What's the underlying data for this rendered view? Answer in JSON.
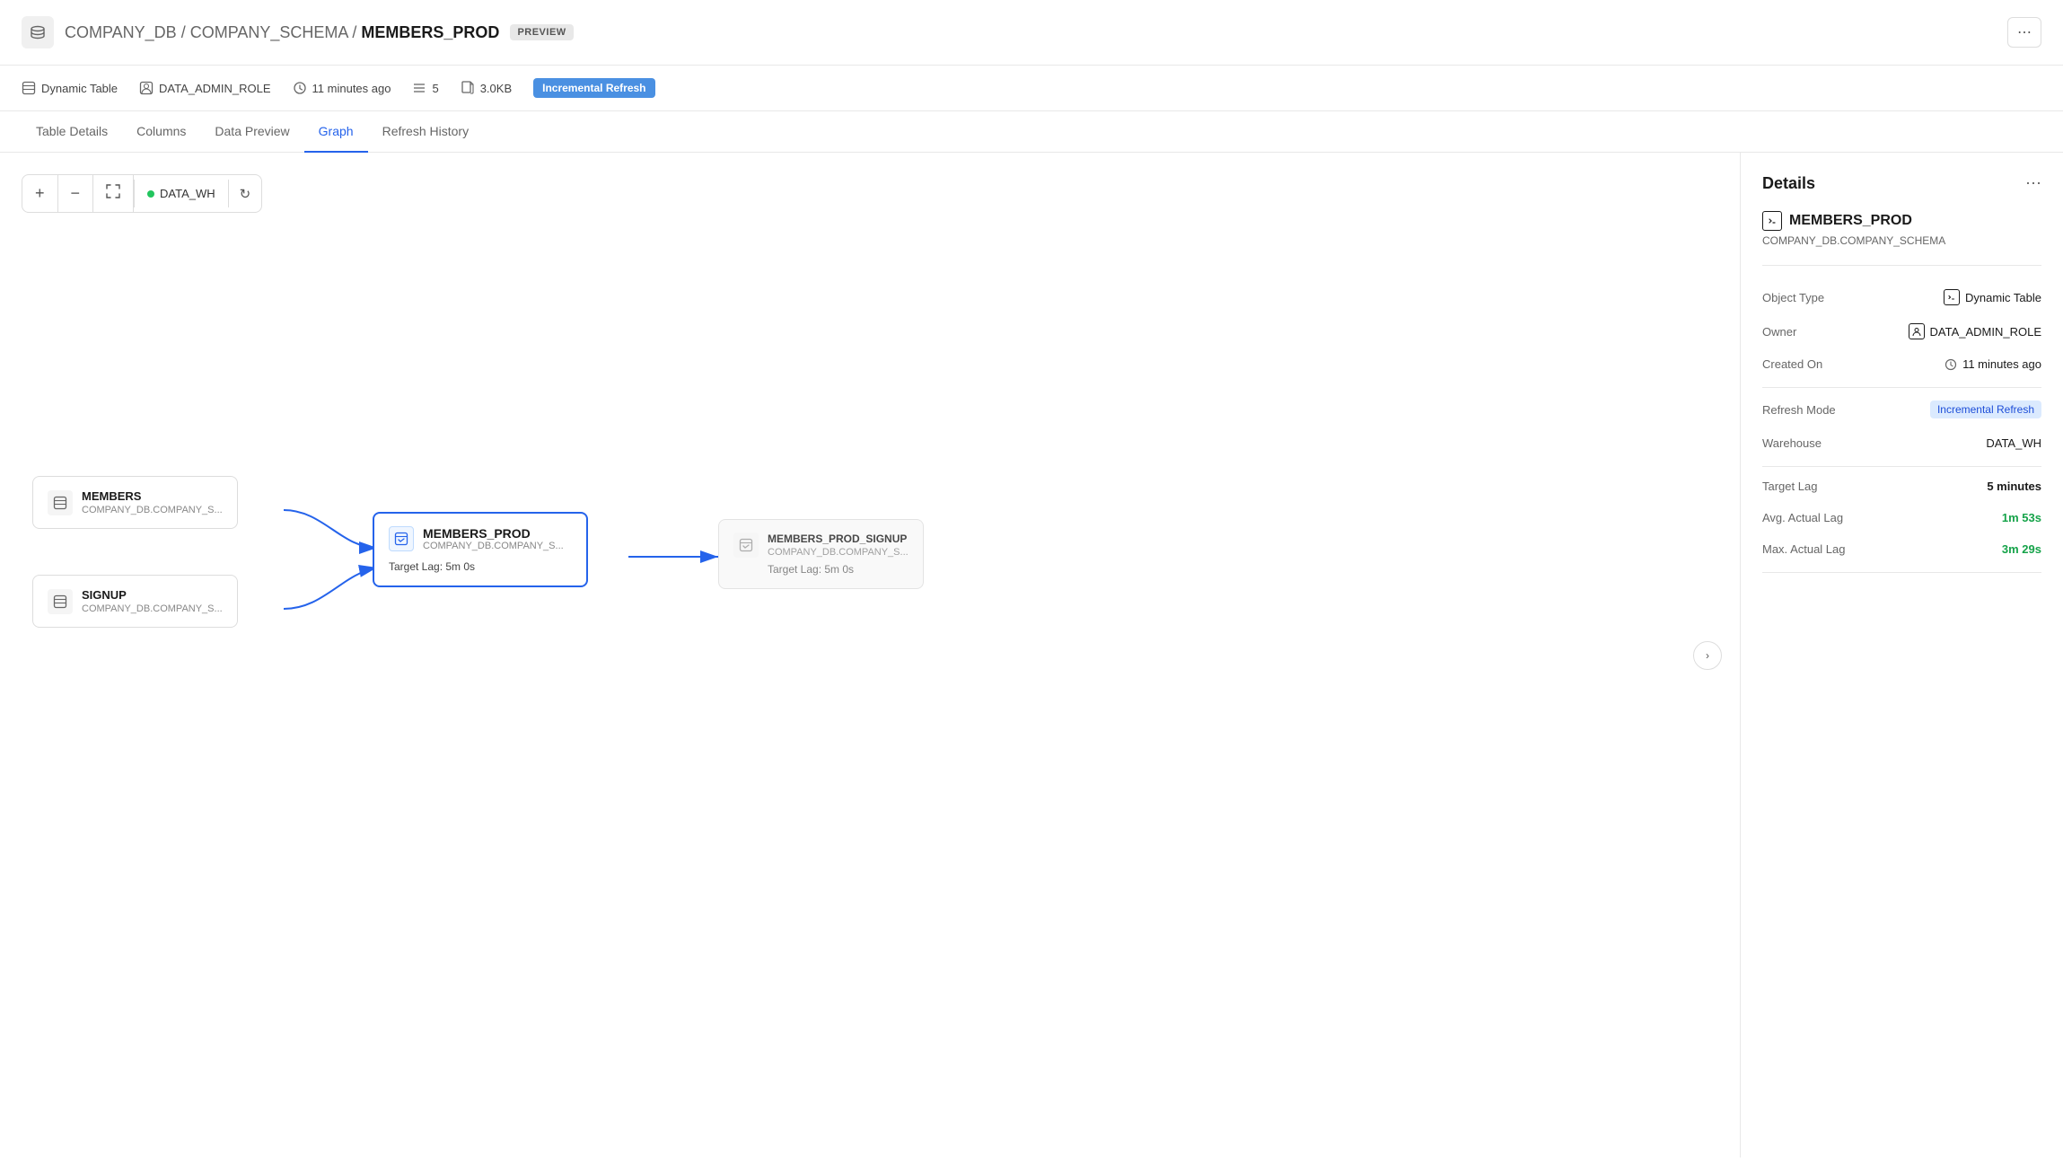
{
  "header": {
    "breadcrumb": "COMPANY_DB / COMPANY_SCHEMA / ",
    "title": "MEMBERS_PROD",
    "badge": "PREVIEW",
    "more_label": "⋯"
  },
  "meta": {
    "object_type": "Dynamic Table",
    "role": "DATA_ADMIN_ROLE",
    "time_ago": "11 minutes ago",
    "rows": "5",
    "size": "3.0KB",
    "refresh_mode": "Incremental Refresh"
  },
  "tabs": [
    {
      "label": "Table Details",
      "active": false
    },
    {
      "label": "Columns",
      "active": false
    },
    {
      "label": "Data Preview",
      "active": false
    },
    {
      "label": "Graph",
      "active": true
    },
    {
      "label": "Refresh History",
      "active": false
    }
  ],
  "graph": {
    "controls": {
      "zoom_in": "+",
      "zoom_out": "−",
      "fit": "⤢",
      "warehouse_name": "DATA_WH",
      "refresh": "↻"
    },
    "source_nodes": [
      {
        "name": "MEMBERS",
        "schema": "COMPANY_DB.COMPANY_S..."
      },
      {
        "name": "SIGNUP",
        "schema": "COMPANY_DB.COMPANY_S..."
      }
    ],
    "main_node": {
      "name": "MEMBERS_PROD",
      "schema": "COMPANY_DB.COMPANY_S...",
      "target_lag": "Target Lag: 5m 0s"
    },
    "downstream_node": {
      "name": "MEMBERS_PROD_SIGNUP",
      "schema": "COMPANY_DB.COMPANY_S...",
      "target_lag": "Target Lag: 5m 0s"
    },
    "expand_label": "›"
  },
  "details": {
    "title": "Details",
    "more": "⋯",
    "object_name": "MEMBERS_PROD",
    "schema": "COMPANY_DB.COMPANY_SCHEMA",
    "rows": [
      {
        "label": "Object Type",
        "value": "Dynamic Table",
        "type": "icon-text"
      },
      {
        "label": "Owner",
        "value": "DATA_ADMIN_ROLE",
        "type": "icon-text"
      },
      {
        "label": "Created On",
        "value": "11 minutes ago",
        "type": "time"
      },
      {
        "label": "Refresh Mode",
        "value": "Incremental Refresh",
        "type": "badge"
      },
      {
        "label": "Warehouse",
        "value": "DATA_WH",
        "type": "text"
      },
      {
        "label": "Target Lag",
        "value": "5 minutes",
        "type": "bold"
      },
      {
        "label": "Avg. Actual Lag",
        "value": "1m 53s",
        "type": "green"
      },
      {
        "label": "Max. Actual Lag",
        "value": "3m 29s",
        "type": "green"
      }
    ]
  }
}
